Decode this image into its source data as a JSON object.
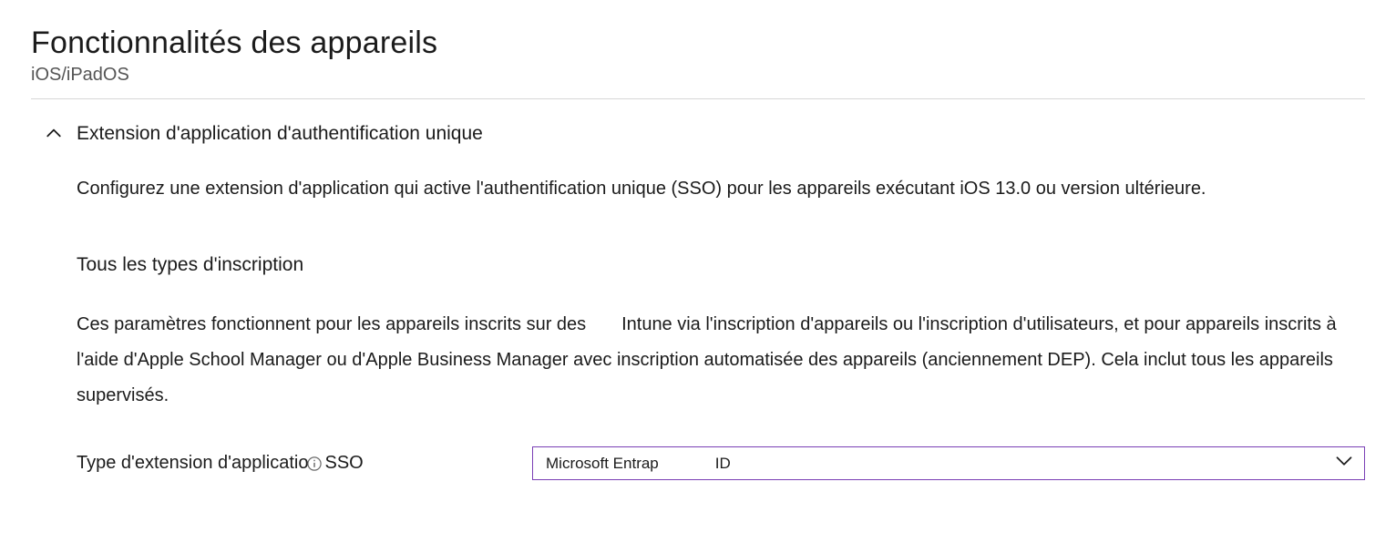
{
  "page": {
    "title": "Fonctionnalités des appareils",
    "subtitle": "iOS/iPadOS"
  },
  "section": {
    "title": "Extension d'application d'authentification unique",
    "description": "Configurez une extension d'application qui active l'authentification unique (SSO) pour les appareils exécutant iOS 13.0 ou version ultérieure.",
    "subsection_title": "Tous les types d'inscription",
    "subsection_desc_part1": "Ces paramètres fonctionnent pour les appareils inscrits sur des",
    "subsection_desc_part2": "Intune via l'inscription d'appareils ou l'inscription d'utilisateurs, et pour appareils inscrits à l'aide d'Apple School Manager ou d'Apple Business Manager avec inscription automatisée des appareils (anciennement DEP). Cela inclut tous les appareils supervisés."
  },
  "form": {
    "sso_type_label_part1": "Type d'extension d'applicatio",
    "sso_type_label_part2": "SSO",
    "sso_type_value_part1": "Microsoft Entrap",
    "sso_type_value_part2": "ID"
  }
}
